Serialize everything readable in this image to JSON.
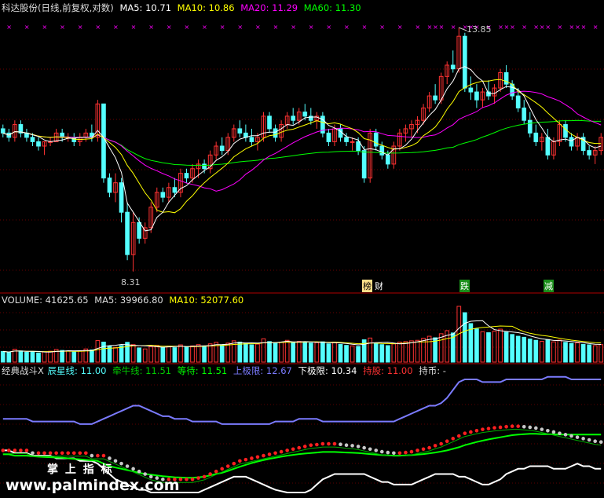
{
  "price_header": {
    "title": "科达股份(日线,前复权,对数)",
    "ma5_label": "MA5: 10.71",
    "ma10_label": "MA10: 10.86",
    "ma20_label": "MA20: 11.29",
    "ma60_label": "MA60: 11.30"
  },
  "volume_header": {
    "volume_label": "VOLUME: 41625.65",
    "ma5_label": "MA5: 39966.80",
    "ma10_label": "MA10: 52077.60"
  },
  "indicator_header": {
    "name": "经典战斗X",
    "chenxing_label": "辰星线: 11.00",
    "qianniu_label": "牵牛线: 11.51",
    "dengdai_label": "等待: 11.51",
    "shangjixian_label": "上极限: 12.67",
    "xiajixian_label": "下极限: 10.34",
    "chigu_label": "持股: 11.00",
    "chibi_label": "持币: -"
  },
  "annotations": {
    "high_label": "13.85",
    "low_label": "8.31",
    "tag_1a": "榜",
    "tag_1b": "财",
    "tag_2": "跌",
    "tag_3": "减"
  },
  "watermark": {
    "text_top": "掌 上 指 标",
    "text_bottom": "www.palmindex.com"
  },
  "colors": {
    "up": "#ff3232",
    "down": "#54ffff",
    "ma5": "#ffffff",
    "ma10": "#ffff00",
    "ma20": "#ff00ff",
    "ma60": "#00ff00",
    "upper_limit": "#7b7bff",
    "lower_limit": "#ffffff",
    "chenxing": "#00ff00",
    "divider": "#b00000"
  },
  "chart_data": {
    "type": "candlestick",
    "price_range": [
      8.0,
      14.2
    ],
    "high": 13.85,
    "low": 8.31,
    "candles": [
      [
        11.2,
        11.3,
        11.0,
        11.1
      ],
      [
        11.1,
        11.2,
        10.9,
        11.0
      ],
      [
        11.0,
        11.4,
        10.9,
        11.3
      ],
      [
        11.3,
        11.4,
        11.0,
        11.1
      ],
      [
        11.1,
        11.2,
        10.9,
        11.0
      ],
      [
        11.0,
        11.1,
        10.8,
        10.9
      ],
      [
        10.9,
        11.0,
        10.7,
        10.8
      ],
      [
        10.8,
        10.9,
        10.6,
        10.9
      ],
      [
        10.9,
        11.0,
        10.8,
        10.9
      ],
      [
        10.9,
        11.2,
        10.9,
        11.1
      ],
      [
        11.1,
        11.2,
        10.9,
        11.0
      ],
      [
        11.0,
        11.1,
        10.9,
        11.0
      ],
      [
        11.0,
        11.1,
        10.8,
        10.9
      ],
      [
        10.9,
        11.1,
        10.8,
        11.0
      ],
      [
        11.0,
        11.2,
        10.9,
        11.1
      ],
      [
        11.1,
        11.3,
        10.9,
        11.0
      ],
      [
        11.0,
        11.9,
        10.9,
        11.8
      ],
      [
        11.8,
        11.8,
        10.0,
        10.1
      ],
      [
        10.1,
        10.2,
        9.7,
        9.8
      ],
      [
        9.8,
        10.2,
        9.6,
        10.0
      ],
      [
        10.0,
        10.1,
        9.2,
        9.4
      ],
      [
        9.4,
        9.6,
        8.5,
        8.6
      ],
      [
        8.6,
        9.4,
        8.3,
        9.2
      ],
      [
        9.2,
        9.3,
        8.8,
        8.9
      ],
      [
        8.9,
        9.2,
        8.8,
        9.1
      ],
      [
        9.1,
        9.6,
        9.0,
        9.5
      ],
      [
        9.5,
        9.9,
        9.4,
        9.8
      ],
      [
        9.8,
        9.9,
        9.6,
        9.7
      ],
      [
        9.7,
        10.0,
        9.6,
        9.9
      ],
      [
        9.9,
        10.1,
        9.7,
        9.8
      ],
      [
        9.8,
        10.3,
        9.7,
        10.2
      ],
      [
        10.2,
        10.3,
        10.0,
        10.1
      ],
      [
        10.1,
        10.4,
        10.0,
        10.3
      ],
      [
        10.3,
        10.5,
        10.1,
        10.4
      ],
      [
        10.4,
        10.5,
        10.2,
        10.3
      ],
      [
        10.3,
        10.7,
        10.2,
        10.6
      ],
      [
        10.6,
        10.9,
        10.5,
        10.8
      ],
      [
        10.8,
        11.0,
        10.6,
        10.7
      ],
      [
        10.7,
        11.1,
        10.6,
        11.0
      ],
      [
        11.0,
        11.3,
        10.9,
        11.2
      ],
      [
        11.2,
        11.4,
        11.0,
        11.1
      ],
      [
        11.1,
        11.3,
        10.9,
        11.0
      ],
      [
        11.0,
        11.2,
        10.8,
        10.9
      ],
      [
        10.9,
        11.1,
        10.7,
        11.0
      ],
      [
        11.0,
        11.6,
        10.9,
        11.5
      ],
      [
        11.5,
        11.6,
        11.1,
        11.2
      ],
      [
        11.2,
        11.3,
        10.9,
        11.0
      ],
      [
        11.0,
        11.4,
        10.9,
        11.3
      ],
      [
        11.3,
        11.6,
        11.2,
        11.5
      ],
      [
        11.5,
        11.7,
        11.3,
        11.4
      ],
      [
        11.4,
        11.7,
        11.3,
        11.6
      ],
      [
        11.6,
        11.8,
        11.4,
        11.5
      ],
      [
        11.5,
        11.7,
        11.3,
        11.4
      ],
      [
        11.4,
        11.6,
        11.2,
        11.5
      ],
      [
        11.5,
        11.6,
        11.0,
        11.1
      ],
      [
        11.1,
        11.2,
        10.8,
        10.9
      ],
      [
        10.9,
        11.3,
        10.8,
        11.2
      ],
      [
        11.2,
        11.3,
        10.9,
        11.0
      ],
      [
        11.0,
        11.1,
        10.8,
        10.9
      ],
      [
        10.9,
        11.0,
        10.7,
        10.9
      ],
      [
        10.9,
        11.0,
        10.6,
        10.7
      ],
      [
        10.7,
        10.8,
        10.0,
        10.1
      ],
      [
        10.1,
        11.2,
        10.0,
        11.1
      ],
      [
        11.1,
        11.2,
        10.7,
        10.8
      ],
      [
        10.8,
        10.9,
        10.5,
        10.6
      ],
      [
        10.6,
        10.7,
        10.3,
        10.4
      ],
      [
        10.4,
        10.9,
        10.3,
        10.8
      ],
      [
        10.8,
        11.2,
        10.7,
        11.1
      ],
      [
        11.1,
        11.3,
        10.9,
        11.2
      ],
      [
        11.2,
        11.4,
        11.0,
        11.3
      ],
      [
        11.3,
        11.5,
        11.1,
        11.4
      ],
      [
        11.4,
        11.8,
        11.3,
        11.7
      ],
      [
        11.7,
        12.1,
        11.6,
        12.0
      ],
      [
        12.0,
        12.3,
        11.8,
        11.9
      ],
      [
        11.9,
        12.6,
        11.8,
        12.5
      ],
      [
        12.5,
        12.9,
        12.3,
        12.8
      ],
      [
        12.8,
        13.2,
        12.6,
        12.7
      ],
      [
        12.7,
        13.85,
        12.6,
        13.6
      ],
      [
        13.6,
        13.7,
        12.1,
        12.2
      ],
      [
        12.2,
        12.5,
        11.9,
        12.1
      ],
      [
        12.1,
        12.3,
        11.7,
        11.9
      ],
      [
        11.9,
        12.2,
        11.7,
        12.1
      ],
      [
        12.1,
        12.4,
        11.9,
        12.0
      ],
      [
        12.0,
        12.3,
        11.8,
        12.2
      ],
      [
        12.2,
        12.7,
        12.1,
        12.6
      ],
      [
        12.6,
        12.8,
        12.2,
        12.3
      ],
      [
        12.3,
        12.4,
        11.9,
        12.0
      ],
      [
        12.0,
        12.2,
        11.6,
        11.7
      ],
      [
        11.7,
        11.9,
        11.3,
        11.4
      ],
      [
        11.4,
        11.6,
        11.0,
        11.1
      ],
      [
        11.1,
        11.3,
        10.8,
        10.9
      ],
      [
        10.9,
        11.1,
        10.7,
        11.0
      ],
      [
        11.0,
        11.2,
        10.5,
        10.6
      ],
      [
        10.6,
        11.0,
        10.5,
        10.9
      ],
      [
        10.9,
        11.4,
        10.8,
        11.3
      ],
      [
        11.3,
        11.4,
        10.9,
        11.0
      ],
      [
        11.0,
        11.1,
        10.7,
        10.8
      ],
      [
        10.8,
        11.1,
        10.7,
        11.0
      ],
      [
        11.0,
        11.1,
        10.6,
        10.7
      ],
      [
        10.7,
        10.8,
        10.5,
        10.6
      ],
      [
        10.6,
        10.8,
        10.4,
        10.7
      ],
      [
        10.7,
        11.1,
        10.6,
        11.0
      ]
    ],
    "volume": [
      4.2,
      3.8,
      5.1,
      4.4,
      3.9,
      4.0,
      3.6,
      4.1,
      4.3,
      5.0,
      4.6,
      4.4,
      4.0,
      4.5,
      5.2,
      4.8,
      8.5,
      7.9,
      6.2,
      5.8,
      6.5,
      7.8,
      6.9,
      5.6,
      5.2,
      6.1,
      6.6,
      5.9,
      6.3,
      5.7,
      6.8,
      6.0,
      6.4,
      6.9,
      6.1,
      7.2,
      7.8,
      6.7,
      7.5,
      8.4,
      7.9,
      7.3,
      6.8,
      7.1,
      9.2,
      8.1,
      7.4,
      7.9,
      8.6,
      7.8,
      8.2,
      7.9,
      7.5,
      7.7,
      8.0,
      7.2,
      7.9,
      7.0,
      6.6,
      6.4,
      6.2,
      8.8,
      9.5,
      7.4,
      6.9,
      6.5,
      7.2,
      7.9,
      8.1,
      8.4,
      8.6,
      9.4,
      10.2,
      9.6,
      11.2,
      12.4,
      11.5,
      22.0,
      19.5,
      15.2,
      13.1,
      12.0,
      11.6,
      12.2,
      13.0,
      11.8,
      10.9,
      10.2,
      9.8,
      9.1,
      8.6,
      8.2,
      8.9,
      8.0,
      8.7,
      7.8,
      7.4,
      7.6,
      7.0,
      6.8,
      6.5,
      6.9
    ],
    "indicator": {
      "upper_limit": [
        12.7,
        12.7,
        12.7,
        12.7,
        12.7,
        12.6,
        12.6,
        12.6,
        12.6,
        12.6,
        12.6,
        12.6,
        12.6,
        12.5,
        12.5,
        12.5,
        12.6,
        12.7,
        12.8,
        12.9,
        13.0,
        13.1,
        13.2,
        13.2,
        13.1,
        13.0,
        12.9,
        12.8,
        12.8,
        12.7,
        12.7,
        12.7,
        12.6,
        12.6,
        12.6,
        12.6,
        12.6,
        12.5,
        12.5,
        12.5,
        12.5,
        12.5,
        12.5,
        12.5,
        12.5,
        12.5,
        12.6,
        12.6,
        12.6,
        12.6,
        12.7,
        12.7,
        12.7,
        12.7,
        12.6,
        12.6,
        12.6,
        12.6,
        12.6,
        12.6,
        12.6,
        12.6,
        12.6,
        12.6,
        12.6,
        12.6,
        12.6,
        12.7,
        12.8,
        12.9,
        13.0,
        13.1,
        13.2,
        13.2,
        13.3,
        13.5,
        13.8,
        14.1,
        14.2,
        14.2,
        14.2,
        14.1,
        14.1,
        14.1,
        14.1,
        14.2,
        14.2,
        14.2,
        14.2,
        14.2,
        14.2,
        14.2,
        14.3,
        14.3,
        14.3,
        14.3,
        14.2,
        14.2,
        14.2,
        14.2,
        14.2,
        14.2
      ],
      "lower_limit": [
        11.5,
        11.5,
        11.4,
        11.4,
        11.4,
        11.3,
        11.3,
        11.3,
        11.3,
        11.2,
        11.2,
        11.2,
        11.2,
        11.1,
        11.1,
        11.1,
        11.0,
        10.8,
        10.6,
        10.4,
        10.3,
        10.2,
        10.1,
        10.0,
        10.0,
        9.9,
        9.9,
        9.9,
        9.9,
        9.9,
        9.9,
        9.9,
        9.9,
        9.9,
        10.0,
        10.1,
        10.2,
        10.3,
        10.4,
        10.5,
        10.5,
        10.5,
        10.4,
        10.3,
        10.2,
        10.1,
        10.0,
        9.95,
        9.9,
        9.9,
        9.9,
        9.9,
        10.0,
        10.2,
        10.4,
        10.5,
        10.6,
        10.6,
        10.6,
        10.6,
        10.6,
        10.6,
        10.5,
        10.4,
        10.3,
        10.3,
        10.2,
        10.2,
        10.2,
        10.2,
        10.3,
        10.4,
        10.5,
        10.6,
        10.6,
        10.6,
        10.6,
        10.5,
        10.5,
        10.4,
        10.3,
        10.2,
        10.2,
        10.3,
        10.4,
        10.6,
        10.7,
        10.8,
        10.8,
        10.9,
        10.9,
        10.9,
        10.9,
        10.8,
        10.8,
        10.8,
        10.9,
        11.0,
        10.9,
        10.9,
        10.8,
        10.8
      ],
      "dotted_line": [
        11.5,
        11.5,
        11.5,
        11.5,
        11.5,
        11.4,
        11.4,
        11.4,
        11.4,
        11.4,
        11.4,
        11.4,
        11.4,
        11.4,
        11.4,
        11.3,
        11.3,
        11.3,
        11.2,
        11.1,
        11.0,
        10.9,
        10.8,
        10.7,
        10.6,
        10.5,
        10.45,
        10.4,
        10.4,
        10.4,
        10.4,
        10.4,
        10.4,
        10.45,
        10.5,
        10.6,
        10.7,
        10.8,
        10.9,
        11.0,
        11.1,
        11.15,
        11.2,
        11.25,
        11.3,
        11.35,
        11.4,
        11.45,
        11.5,
        11.55,
        11.6,
        11.65,
        11.7,
        11.72,
        11.75,
        11.75,
        11.75,
        11.73,
        11.7,
        11.68,
        11.65,
        11.6,
        11.55,
        11.5,
        11.45,
        11.42,
        11.4,
        11.4,
        11.42,
        11.45,
        11.5,
        11.55,
        11.6,
        11.68,
        11.75,
        11.85,
        11.95,
        12.05,
        12.15,
        12.2,
        12.25,
        12.3,
        12.33,
        12.36,
        12.38,
        12.4,
        12.42,
        12.42,
        12.4,
        12.38,
        12.35,
        12.3,
        12.25,
        12.2,
        12.15,
        12.1,
        12.05,
        12.0,
        11.95,
        11.9,
        11.85,
        11.82
      ],
      "chenxing": [
        11.35,
        11.35,
        11.3,
        11.3,
        11.3,
        11.28,
        11.26,
        11.25,
        11.24,
        11.23,
        11.22,
        11.2,
        11.18,
        11.16,
        11.14,
        11.12,
        11.1,
        11.0,
        10.9,
        10.85,
        10.8,
        10.75,
        10.7,
        10.65,
        10.6,
        10.58,
        10.55,
        10.52,
        10.5,
        10.48,
        10.47,
        10.46,
        10.46,
        10.48,
        10.5,
        10.55,
        10.6,
        10.65,
        10.72,
        10.8,
        10.88,
        10.95,
        11.02,
        11.08,
        11.13,
        11.18,
        11.22,
        11.26,
        11.3,
        11.33,
        11.36,
        11.38,
        11.4,
        11.42,
        11.44,
        11.44,
        11.44,
        11.43,
        11.42,
        11.41,
        11.4,
        11.38,
        11.36,
        11.34,
        11.32,
        11.31,
        11.3,
        11.3,
        11.31,
        11.32,
        11.34,
        11.36,
        11.39,
        11.42,
        11.46,
        11.5,
        11.56,
        11.62,
        11.7,
        11.76,
        11.82,
        11.87,
        11.92,
        11.96,
        12.0,
        12.04,
        12.08,
        12.1,
        12.12,
        12.13,
        12.13,
        12.12,
        12.12,
        12.11,
        12.1,
        12.1,
        12.1,
        12.1,
        12.1,
        12.1,
        12.1,
        12.1
      ]
    }
  }
}
